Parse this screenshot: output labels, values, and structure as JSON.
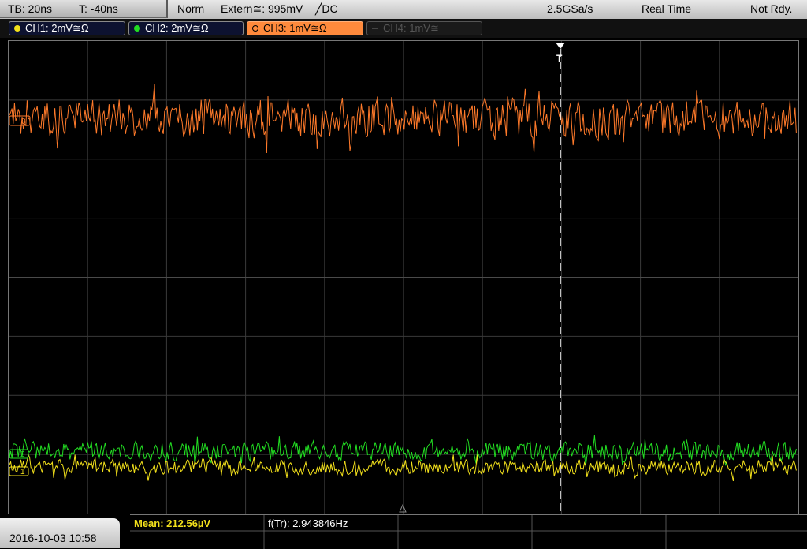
{
  "topbar": {
    "timebase": "TB: 20ns",
    "trigger_time": "T: -40ns",
    "mode": "Norm",
    "trigger_source": "Extern≅: 995mV",
    "trigger_edge": "╱DC",
    "sample_rate": "2.5GSa/s",
    "acq_mode": "Real Time",
    "status": "Not Rdy."
  },
  "channels": [
    {
      "label": "CH1: 2mV≅Ω",
      "color": "#f2e01b",
      "active": true
    },
    {
      "label": "CH2: 2mV≅Ω",
      "color": "#22dd22",
      "active": true
    },
    {
      "label": "CH3: 1mV≅Ω",
      "color": "#ff7a2a",
      "active": true,
      "selected": true
    },
    {
      "label": "CH4: 1mV≅",
      "color": "#555555",
      "active": false
    }
  ],
  "markers": {
    "ch1_tag": "1",
    "ch2_tag": "2",
    "ch3_tag": "3",
    "trigger_tag": "T"
  },
  "status": {
    "datetime": "2016-10-03 10:58",
    "mean_label": "Mean: 212.56µV",
    "freq_label": "f(Tr): 2.943846Hz"
  },
  "colors": {
    "ch1": "#f2e01b",
    "ch2": "#22dd22",
    "ch3": "#ff7a2a",
    "grid": "#3a3a3a"
  }
}
